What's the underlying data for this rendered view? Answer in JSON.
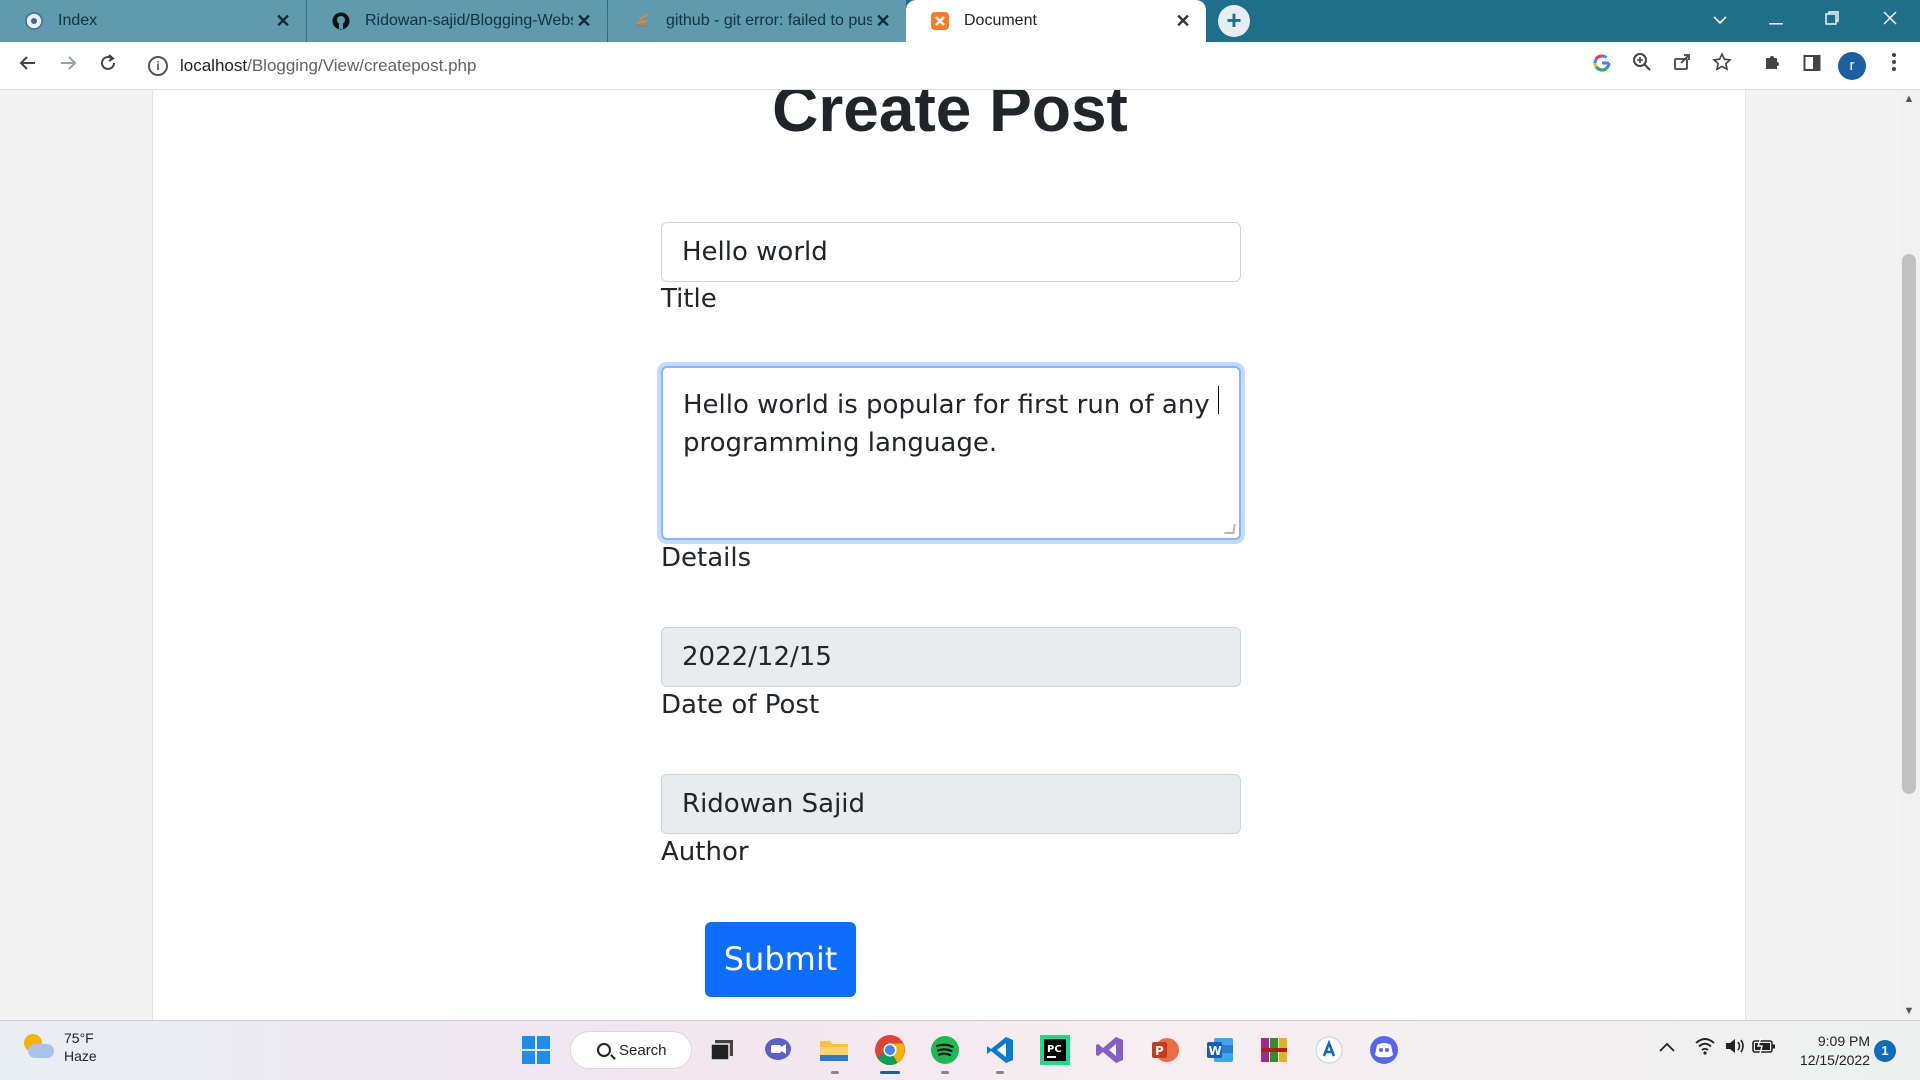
{
  "browser": {
    "tabs": [
      {
        "title": "Index",
        "icon": "globe-icon"
      },
      {
        "title": "Ridowan-sajid/Blogging-Website",
        "icon": "github-icon"
      },
      {
        "title": "github - git error: failed to push s",
        "icon": "stackoverflow-icon"
      },
      {
        "title": "Document",
        "icon": "xampp-icon"
      }
    ],
    "close_glyph": "✕",
    "new_tab_glyph": "+",
    "url_host": "localhost",
    "url_path": "/Blogging/View/createpost.php",
    "profile_initial": "r"
  },
  "page": {
    "title": "Create Post",
    "title_field": {
      "value": "Hello world",
      "label": "Title"
    },
    "details_field": {
      "value": "Hello world is popular for first run of any programming language.",
      "label": "Details"
    },
    "date_field": {
      "value": "2022/12/15",
      "label": "Date of Post"
    },
    "author_field": {
      "value": "Ridowan Sajid",
      "label": "Author"
    },
    "submit_label": "Submit"
  },
  "taskbar": {
    "weather_temp": "75°F",
    "weather_desc": "Haze",
    "search_label": "Search",
    "time": "9:09 PM",
    "date": "12/15/2022",
    "notification_count": "1"
  },
  "colors": {
    "tabstrip": "#1f6f8b",
    "primary_button": "#0d6efd",
    "readonly_field": "#e9ecef"
  }
}
